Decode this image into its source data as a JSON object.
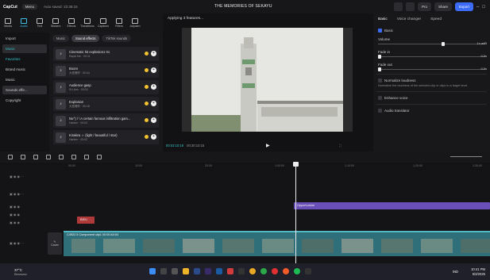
{
  "app": {
    "brand": "CapCut",
    "menu_label": "Menu",
    "autosave": "Auto saved: 22:38:15",
    "project_title": "THE MEMORIES OF SEKAYU",
    "pro_label": "Pro",
    "share_label": "Share",
    "export_label": "Export"
  },
  "toolbar": {
    "tools": [
      "Media",
      "Audio",
      "Text",
      "Stickers",
      "Effects",
      "Transitions",
      "Captions",
      "Filters",
      "Adjustm"
    ]
  },
  "leftnav": {
    "items": [
      "Import",
      "Music",
      "Favorites",
      "Brand music",
      "Music",
      "Sounds effe...",
      "Copyright"
    ]
  },
  "media": {
    "chips": [
      "Music",
      "Sound effects",
      "TikTok sounds"
    ],
    "items": [
      {
        "title": "Cinematic hit explosion1 01",
        "sub": "Rapid fire · 00:11"
      },
      {
        "title": "Boom",
        "sub": "大型爆炸 · 00:04"
      },
      {
        "title": "Audience gasp",
        "sub": "SU Aim · 00:03"
      },
      {
        "title": "Explosion",
        "sub": "大型爆炸 · 00:18"
      },
      {
        "title": "Nu^) / \\ A certain famous infiltration gam...",
        "sub": "Harlem · 00:02"
      },
      {
        "title": "Kirakira ☆ (light / beautiful / star)",
        "sub": "Harlem · 00:02"
      }
    ]
  },
  "player": {
    "header": "Applying 3 features...",
    "timecode": "00:03:10:16",
    "duration": "00:30:10:15"
  },
  "props": {
    "tabs": [
      "Basic",
      "Voice changer",
      "Speed"
    ],
    "basic_label": "Basic",
    "volume_label": "Volume",
    "volume_value": "1x,adB",
    "fade_in_label": "Fade in",
    "fade_in_value": "0.0s",
    "fade_out_label": "Fade out",
    "fade_out_value": "0.0s",
    "normalize_label": "Normalize loudness",
    "normalize_note": "Normalize the loudness of the selected clip or clips to a target level.",
    "enhance_label": "Enhance voice",
    "translator_label": "Audio translator"
  },
  "timeline": {
    "ruler": [
      "00:00",
      "10:00",
      "20:00",
      "1:00:00",
      "1:10:00",
      "1:20:00",
      "1:30:00"
    ],
    "text_clip": "Opportunidar",
    "sfx_clip": "BIEU",
    "main_clip_label": "C4922.5  Component clip1  00:00:44:04",
    "cover_label": "Cover"
  },
  "taskbar": {
    "temp": "37°C",
    "weather": "Berawan",
    "lang": "IND",
    "time": "10:41 PM",
    "date": "5/3/2025"
  },
  "colors": {
    "accent": "#3fc1e6",
    "export": "#3c6cf5",
    "track": "#2f6f7a",
    "textclip": "#6b4fb8"
  }
}
